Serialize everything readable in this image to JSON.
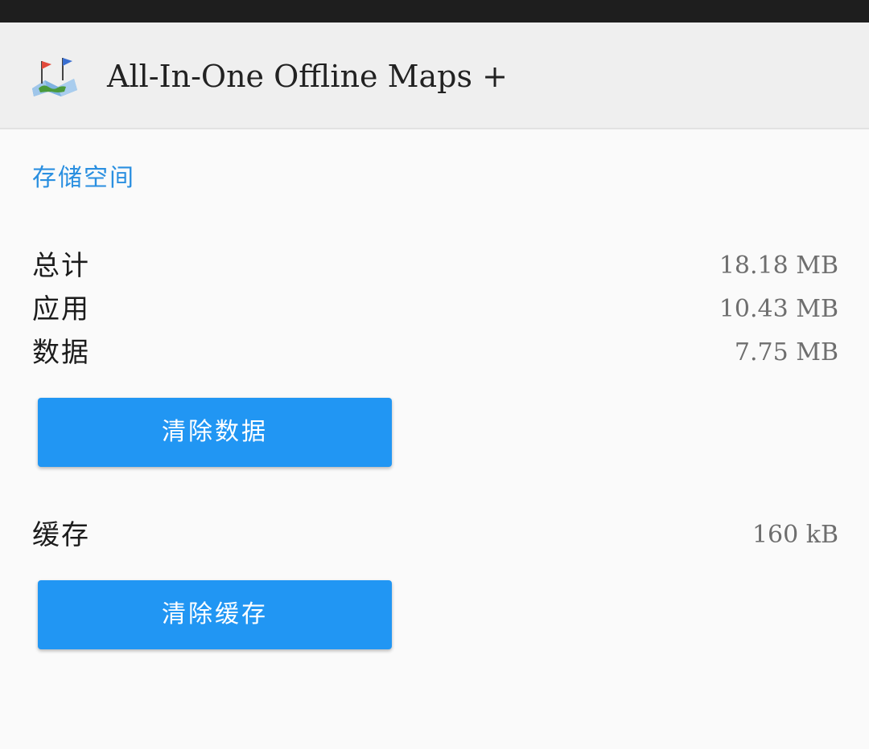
{
  "status_bar": {},
  "app_bar": {
    "icon": "offline-maps-app-icon",
    "title": "All-In-One Offline Maps +"
  },
  "storage": {
    "section_title": "存储空间",
    "total": {
      "label": "总计",
      "value": "18.18 MB"
    },
    "app": {
      "label": "应用",
      "value": "10.43 MB"
    },
    "data": {
      "label": "数据",
      "value": "7.75 MB"
    },
    "clear_data_label": "清除数据",
    "cache": {
      "label": "缓存",
      "value": "160 kB"
    },
    "clear_cache_label": "清除缓存"
  },
  "colors": {
    "accent": "#2196f3",
    "section_header": "#2a8fe0",
    "app_bar_bg": "#efefef",
    "status_bar_bg": "#1e1e1e"
  }
}
